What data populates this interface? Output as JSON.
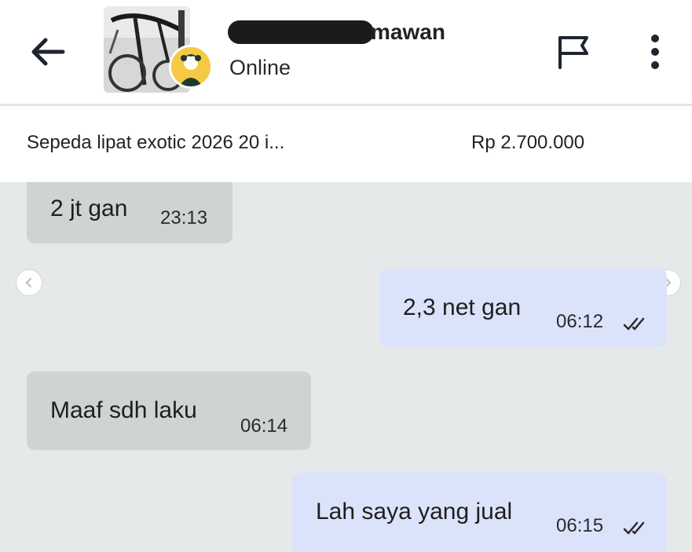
{
  "header": {
    "contact_name_visible": "mawan",
    "status": "Online",
    "icons": {
      "back": "arrow-left-icon",
      "report": "flag-icon",
      "more": "more-vertical-icon"
    }
  },
  "listing": {
    "title": "Sepeda lipat exotic 2026 20 i...",
    "price": "Rp 2.700.000"
  },
  "messages": [
    {
      "direction": "incoming",
      "text": "2 jt gan",
      "time": "23:13",
      "read": false
    },
    {
      "direction": "outgoing",
      "text": "2,3 net gan",
      "time": "06:12",
      "read": true
    },
    {
      "direction": "incoming",
      "text": "Maaf sdh laku",
      "time": "06:14",
      "read": false
    },
    {
      "direction": "outgoing",
      "text": "Lah saya yang jual",
      "time": "06:15",
      "read": true
    }
  ],
  "colors": {
    "incoming_bubble": "#cfd3d3",
    "outgoing_bubble": "#dbe3fb",
    "chat_background": "#e6e9ea",
    "header_background": "#ffffff"
  }
}
